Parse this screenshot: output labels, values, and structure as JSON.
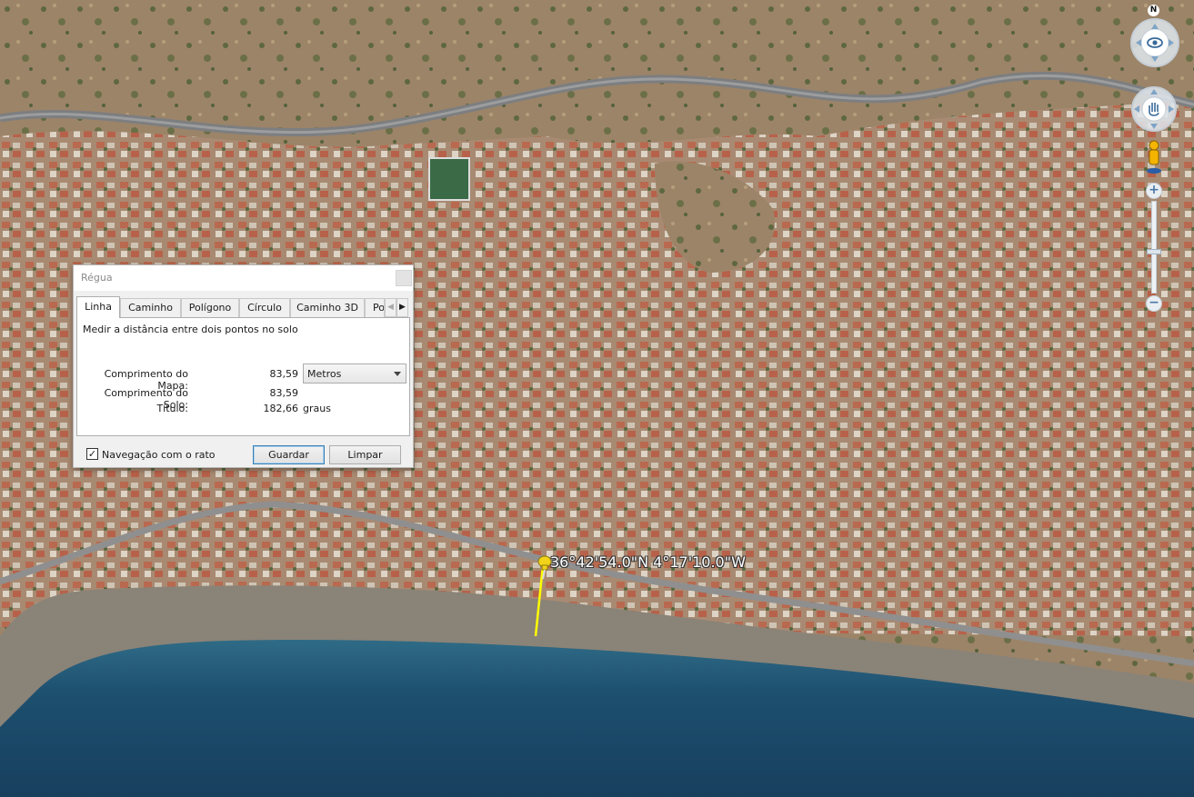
{
  "dialog": {
    "title": "Régua",
    "tabs": [
      "Linha",
      "Caminho",
      "Polígono",
      "Círculo",
      "Caminho 3D",
      "Po"
    ],
    "active_tab": "Linha",
    "description": "Medir a distância entre dois pontos no solo",
    "map_length_label": "Comprimento do Mapa:",
    "map_length_value": "83,59",
    "unit_selected": "Metros",
    "ground_length_label": "Comprimento do Solo:",
    "ground_length_value": "83,59",
    "heading_label": "Título:",
    "heading_value": "182,66",
    "heading_unit": "graus",
    "mouse_nav_label": "Navegação com o rato",
    "mouse_nav_checked": true,
    "save_label": "Guardar",
    "clear_label": "Limpar"
  },
  "placemark": {
    "coords": "36°42'54.0\"N 4°17'10.0\"W",
    "icon": "yellow-pushpin-icon",
    "line_color": "#ffff00"
  },
  "nav": {
    "north_label": "N",
    "zoom_in": "+",
    "zoom_out": "−",
    "zoom_level_fraction": 0.45
  },
  "colors": {
    "sea": "#1d4f6f",
    "beach": "#8a8378",
    "urban": "#b69a84",
    "hills": "#a89274",
    "pin": "#f2d21b"
  }
}
